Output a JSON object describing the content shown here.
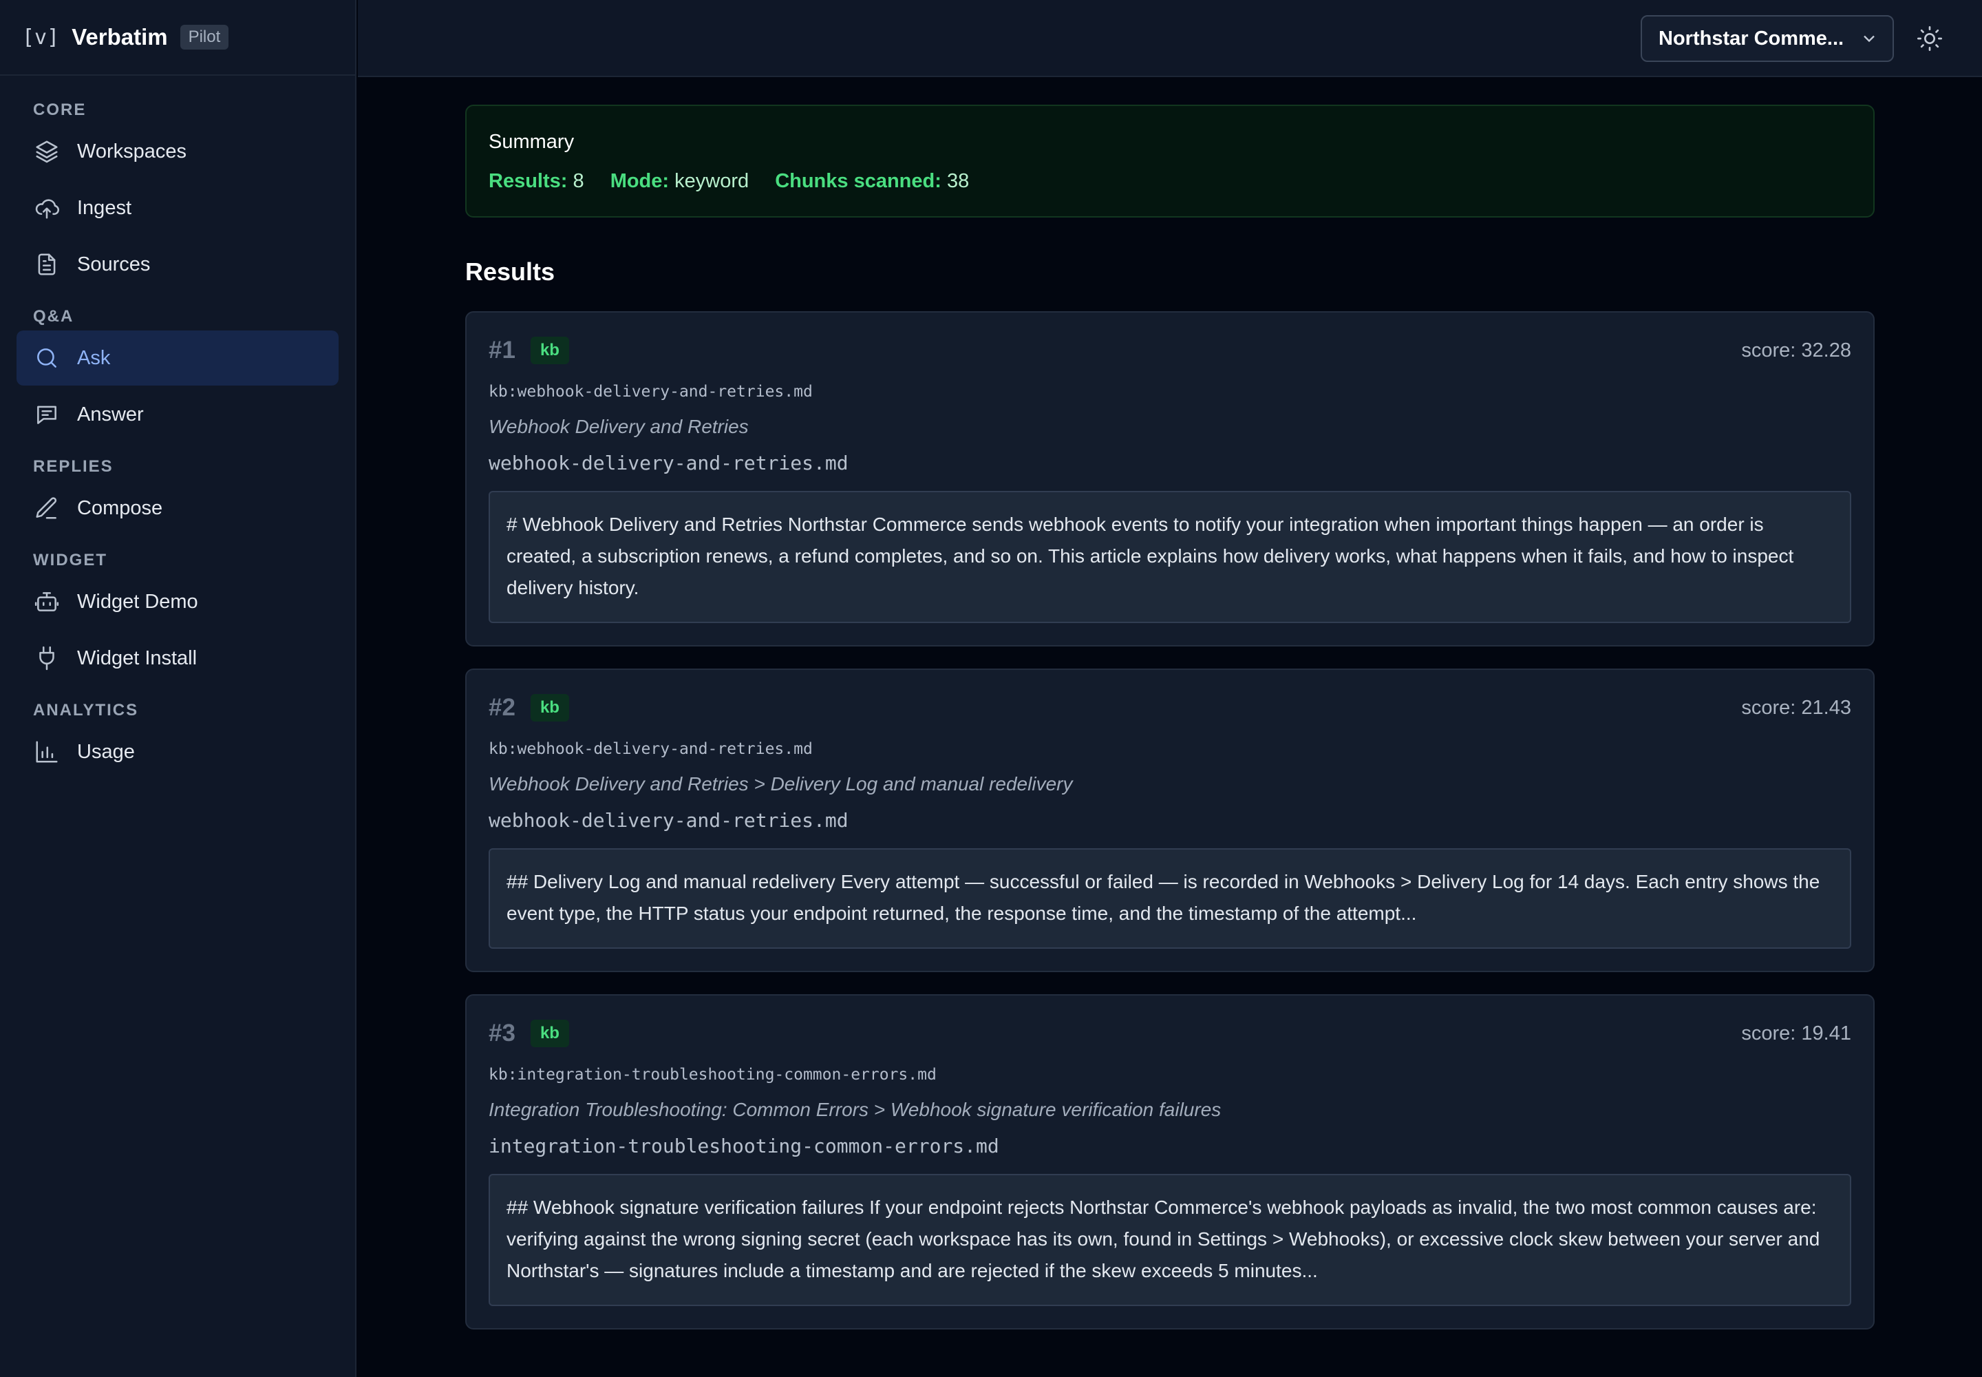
{
  "brand": {
    "mark": "[v]",
    "name": "Verbatim",
    "badge": "Pilot"
  },
  "nav": {
    "sections": [
      {
        "title": "CORE",
        "items": [
          {
            "label": "Workspaces",
            "icon": "layers-icon"
          },
          {
            "label": "Ingest",
            "icon": "cloud-upload-icon"
          },
          {
            "label": "Sources",
            "icon": "file-text-icon"
          }
        ]
      },
      {
        "title": "Q&A",
        "items": [
          {
            "label": "Ask",
            "icon": "search-icon",
            "active": true
          },
          {
            "label": "Answer",
            "icon": "message-icon"
          }
        ]
      },
      {
        "title": "REPLIES",
        "items": [
          {
            "label": "Compose",
            "icon": "pen-icon"
          }
        ]
      },
      {
        "title": "WIDGET",
        "items": [
          {
            "label": "Widget Demo",
            "icon": "bot-icon"
          },
          {
            "label": "Widget Install",
            "icon": "plug-icon"
          }
        ]
      },
      {
        "title": "ANALYTICS",
        "items": [
          {
            "label": "Usage",
            "icon": "bar-chart-icon"
          }
        ]
      }
    ]
  },
  "topbar": {
    "workspace": "Northstar Comme...",
    "workspace_icon": "chevron-down-icon",
    "theme_icon": "sun-icon"
  },
  "summary": {
    "title": "Summary",
    "results_label": "Results:",
    "results_value": "8",
    "mode_label": "Mode:",
    "mode_value": "keyword",
    "chunks_label": "Chunks scanned:",
    "chunks_value": "38"
  },
  "results_heading": "Results",
  "results": [
    {
      "rank": "#1",
      "tag": "kb",
      "score": "score: 32.28",
      "id": "kb:webhook-delivery-and-retries.md",
      "path": "Webhook Delivery and Retries",
      "file": "webhook-delivery-and-retries.md",
      "snippet": "# Webhook Delivery and Retries Northstar Commerce sends webhook events to notify your integration when important things happen — an order is created, a subscription renews, a refund completes, and so on. This article explains how delivery works, what happens when it fails, and how to inspect delivery history."
    },
    {
      "rank": "#2",
      "tag": "kb",
      "score": "score: 21.43",
      "id": "kb:webhook-delivery-and-retries.md",
      "path": "Webhook Delivery and Retries > Delivery Log and manual redelivery",
      "file": "webhook-delivery-and-retries.md",
      "snippet": "## Delivery Log and manual redelivery Every attempt — successful or failed — is recorded in Webhooks > Delivery Log for 14 days. Each entry shows the event type, the HTTP status your endpoint returned, the response time, and the timestamp of the attempt..."
    },
    {
      "rank": "#3",
      "tag": "kb",
      "score": "score: 19.41",
      "id": "kb:integration-troubleshooting-common-errors.md",
      "path": "Integration Troubleshooting: Common Errors > Webhook signature verification failures",
      "file": "integration-troubleshooting-common-errors.md",
      "snippet": "## Webhook signature verification failures If your endpoint rejects Northstar Commerce's webhook payloads as invalid, the two most common causes are: verifying against the wrong signing secret (each workspace has its own, found in Settings > Webhooks), or excessive clock skew between your server and Northstar's — signatures include a timestamp and are rejected if the skew exceeds 5 minutes..."
    }
  ]
}
